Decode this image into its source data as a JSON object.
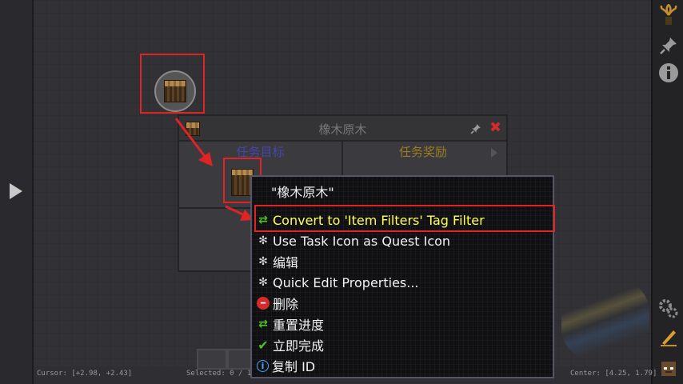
{
  "quest_panel": {
    "title": "橡木原木",
    "tab_tasks": "任务目标",
    "tab_rewards": "任务奖励"
  },
  "context_menu": {
    "title": "\"橡木原木\"",
    "items": [
      {
        "label": "Convert to 'Item Filters' Tag Filter",
        "icon": "convert-icon"
      },
      {
        "label": "Use Task Icon as Quest Icon",
        "icon": "gear-icon"
      },
      {
        "label": "编辑",
        "icon": "gear-icon"
      },
      {
        "label": "Quick Edit Properties...",
        "icon": "gear-icon"
      },
      {
        "label": "删除",
        "icon": "delete-icon"
      },
      {
        "label": "重置进度",
        "icon": "reset-icon"
      },
      {
        "label": "立即完成",
        "icon": "check-icon"
      },
      {
        "label": "复制 ID",
        "icon": "info-icon"
      }
    ]
  },
  "status_bar": {
    "cursor": "Cursor: [+2.98, +2.43]",
    "selected": "Selected: 0 / 1",
    "center": "Center: [4.25, 1.79]"
  },
  "colors": {
    "highlight_border": "#e02424",
    "menu_highlight_text": "#ffff55",
    "tab_tasks": "#4646a8",
    "tab_rewards": "#9a7b22"
  }
}
